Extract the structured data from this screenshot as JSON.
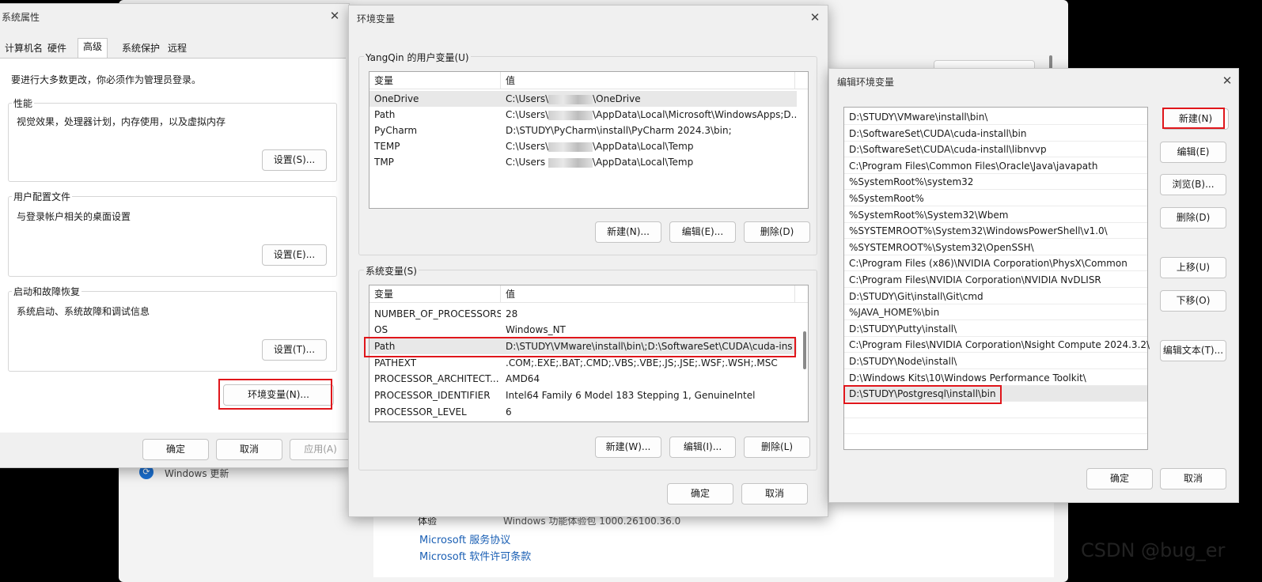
{
  "background": {
    "update_label": "Windows 更新",
    "experience_label": "体验",
    "experience_value": "Windows 功能体验包 1000.26100.36.0",
    "link_service": "Microsoft 服务协议",
    "link_license": "Microsoft 软件许可条款"
  },
  "sysprops": {
    "title": "系统属性",
    "tabs": [
      "计算机名",
      "硬件",
      "高级",
      "系统保护",
      "远程"
    ],
    "notice": "要进行大多数更改，你必须作为管理员登录。",
    "groups": [
      {
        "label": "性能",
        "desc": "视觉效果，处理器计划，内存使用，以及虚拟内存",
        "button": "设置(S)..."
      },
      {
        "label": "用户配置文件",
        "desc": "与登录帐户相关的桌面设置",
        "button": "设置(E)..."
      },
      {
        "label": "启动和故障恢复",
        "desc": "系统启动、系统故障和调试信息",
        "button": "设置(T)..."
      }
    ],
    "env_button": "环境变量(N)...",
    "ok": "确定",
    "cancel": "取消",
    "apply": "应用(A)"
  },
  "envvars": {
    "title": "环境变量",
    "user_group_label": "YangQin 的用户变量(U)",
    "col_var": "变量",
    "col_val": "值",
    "user_vars": [
      {
        "name": "OneDrive",
        "v1": "C:\\Users\\",
        "v2": "\\OneDrive"
      },
      {
        "name": "Path",
        "v1": "C:\\Users\\",
        "v2": "\\AppData\\Local\\Microsoft\\WindowsApps;D..."
      },
      {
        "name": "PyCharm",
        "v1": "D:\\STUDY\\PyCharm\\install\\PyCharm 2024.3\\bin;",
        "v2": ""
      },
      {
        "name": "TEMP",
        "v1": "C:\\Users\\",
        "v2": "\\AppData\\Local\\Temp"
      },
      {
        "name": "TMP",
        "v1": "C:\\Users",
        "v2": "\\AppData\\Local\\Temp"
      }
    ],
    "user_buttons": [
      "新建(N)...",
      "编辑(E)...",
      "删除(D)"
    ],
    "sys_group_label": "系统变量(S)",
    "sys_vars": [
      {
        "name": "NUMBER_OF_PROCESSORS",
        "value": "28"
      },
      {
        "name": "OS",
        "value": "Windows_NT"
      },
      {
        "name": "Path",
        "value": "D:\\STUDY\\VMware\\install\\bin\\;D:\\SoftwareSet\\CUDA\\cuda-ins..."
      },
      {
        "name": "PATHEXT",
        "value": ".COM;.EXE;.BAT;.CMD;.VBS;.VBE;.JS;.JSE;.WSF;.WSH;.MSC"
      },
      {
        "name": "PROCESSOR_ARCHITECT...",
        "value": "AMD64"
      },
      {
        "name": "PROCESSOR_IDENTIFIER",
        "value": "Intel64 Family 6 Model 183 Stepping 1, GenuineIntel"
      },
      {
        "name": "PROCESSOR_LEVEL",
        "value": "6"
      }
    ],
    "sys_buttons": [
      "新建(W)...",
      "编辑(I)...",
      "删除(L)"
    ],
    "ok": "确定",
    "cancel": "取消"
  },
  "editenv": {
    "title": "编辑环境变量",
    "paths": [
      "D:\\STUDY\\VMware\\install\\bin\\",
      "D:\\SoftwareSet\\CUDA\\cuda-install\\bin",
      "D:\\SoftwareSet\\CUDA\\cuda-install\\libnvvp",
      "C:\\Program Files\\Common Files\\Oracle\\Java\\javapath",
      "%SystemRoot%\\system32",
      "%SystemRoot%",
      "%SystemRoot%\\System32\\Wbem",
      "%SYSTEMROOT%\\System32\\WindowsPowerShell\\v1.0\\",
      "%SYSTEMROOT%\\System32\\OpenSSH\\",
      "C:\\Program Files (x86)\\NVIDIA Corporation\\PhysX\\Common",
      "C:\\Program Files\\NVIDIA Corporation\\NVIDIA NvDLISR",
      "D:\\STUDY\\Git\\install\\Git\\cmd",
      "%JAVA_HOME%\\bin",
      "D:\\STUDY\\Putty\\install\\",
      "C:\\Program Files\\NVIDIA Corporation\\Nsight Compute 2024.3.2\\",
      "D:\\STUDY\\Node\\install\\",
      "D:\\Windows Kits\\10\\Windows Performance Toolkit\\",
      "D:\\STUDY\\Postgresql\\install\\bin"
    ],
    "buttons": {
      "new": "新建(N)",
      "edit": "编辑(E)",
      "browse": "浏览(B)...",
      "delete": "删除(D)",
      "up": "上移(U)",
      "down": "下移(O)",
      "edit_text": "编辑文本(T)..."
    },
    "ok": "确定",
    "cancel": "取消"
  },
  "watermark": "CSDN @bug_er"
}
